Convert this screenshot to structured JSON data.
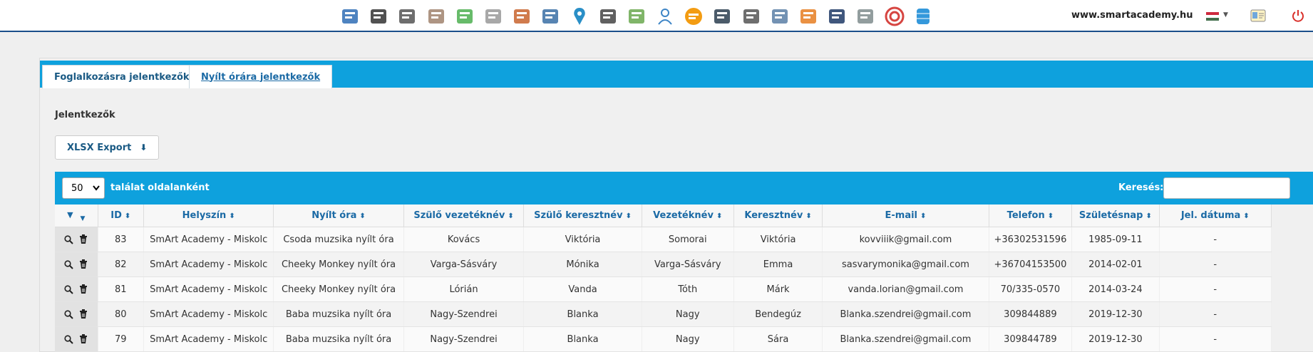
{
  "header": {
    "site": "www.smartacademy.hu",
    "icons": [
      "school-icon",
      "users-icon",
      "translate-icon",
      "notes-icon",
      "slides-icon",
      "newspaper-icon",
      "gallery-icon",
      "teacher-icon",
      "location-pin-icon",
      "piano-icon",
      "painting-icon",
      "person-icon",
      "chat-icon",
      "computer-icon",
      "presentation-icon",
      "id-badge-icon",
      "children-icon",
      "graduation-timer-icon",
      "book-icon",
      "target-icon",
      "database-icon"
    ]
  },
  "tabs": [
    {
      "label": "Foglalkozásra jelentkezők"
    },
    {
      "label": "Nyílt órára jelentkezők"
    }
  ],
  "heading": "Jelentkezők",
  "export_label": "XLSX Export",
  "perpage": {
    "value": "50",
    "label": "találat oldalanként"
  },
  "search": {
    "label": "Keresés:",
    "value": ""
  },
  "columns": [
    "",
    "ID",
    "Helyszín",
    "Nyílt óra",
    "Szülő vezetéknév",
    "Szülő keresztnév",
    "Vezetéknév",
    "Keresztnév",
    "E-mail",
    "Telefon",
    "Születésnap",
    "Jel. dátuma"
  ],
  "rows": [
    [
      "83",
      "SmArt Academy - Miskolc",
      "Csoda muzsika nyílt óra",
      "Kovács",
      "Viktória",
      "Somorai",
      "Viktória",
      "kovviiik@gmail.com",
      "+36302531596",
      "1985-09-11",
      "-"
    ],
    [
      "82",
      "SmArt Academy - Miskolc",
      "Cheeky Monkey nyílt óra",
      "Varga-Sásváry",
      "Mónika",
      "Varga-Sásváry",
      "Emma",
      "sasvarymonika@gmail.com",
      "+36704153500",
      "2014-02-01",
      "-"
    ],
    [
      "81",
      "SmArt Academy - Miskolc",
      "Cheeky Monkey nyílt óra",
      "Lórián",
      "Vanda",
      "Tóth",
      "Márk",
      "vanda.lorian@gmail.com",
      "70/335-0570",
      "2014-03-24",
      "-"
    ],
    [
      "80",
      "SmArt Academy - Miskolc",
      "Baba muzsika nyílt óra",
      "Nagy-Szendrei",
      "Blanka",
      "Nagy",
      "Bendegúz",
      "Blanka.szendrei@gmail.com",
      "309844889",
      "2019-12-30",
      "-"
    ],
    [
      "79",
      "SmArt Academy - Miskolc",
      "Baba muzsika nyílt óra",
      "Nagy-Szendrei",
      "Blanka",
      "Nagy",
      "Sára",
      "Blanka.szendrei@gmail.com",
      "309844789",
      "2019-12-30",
      "-"
    ]
  ]
}
